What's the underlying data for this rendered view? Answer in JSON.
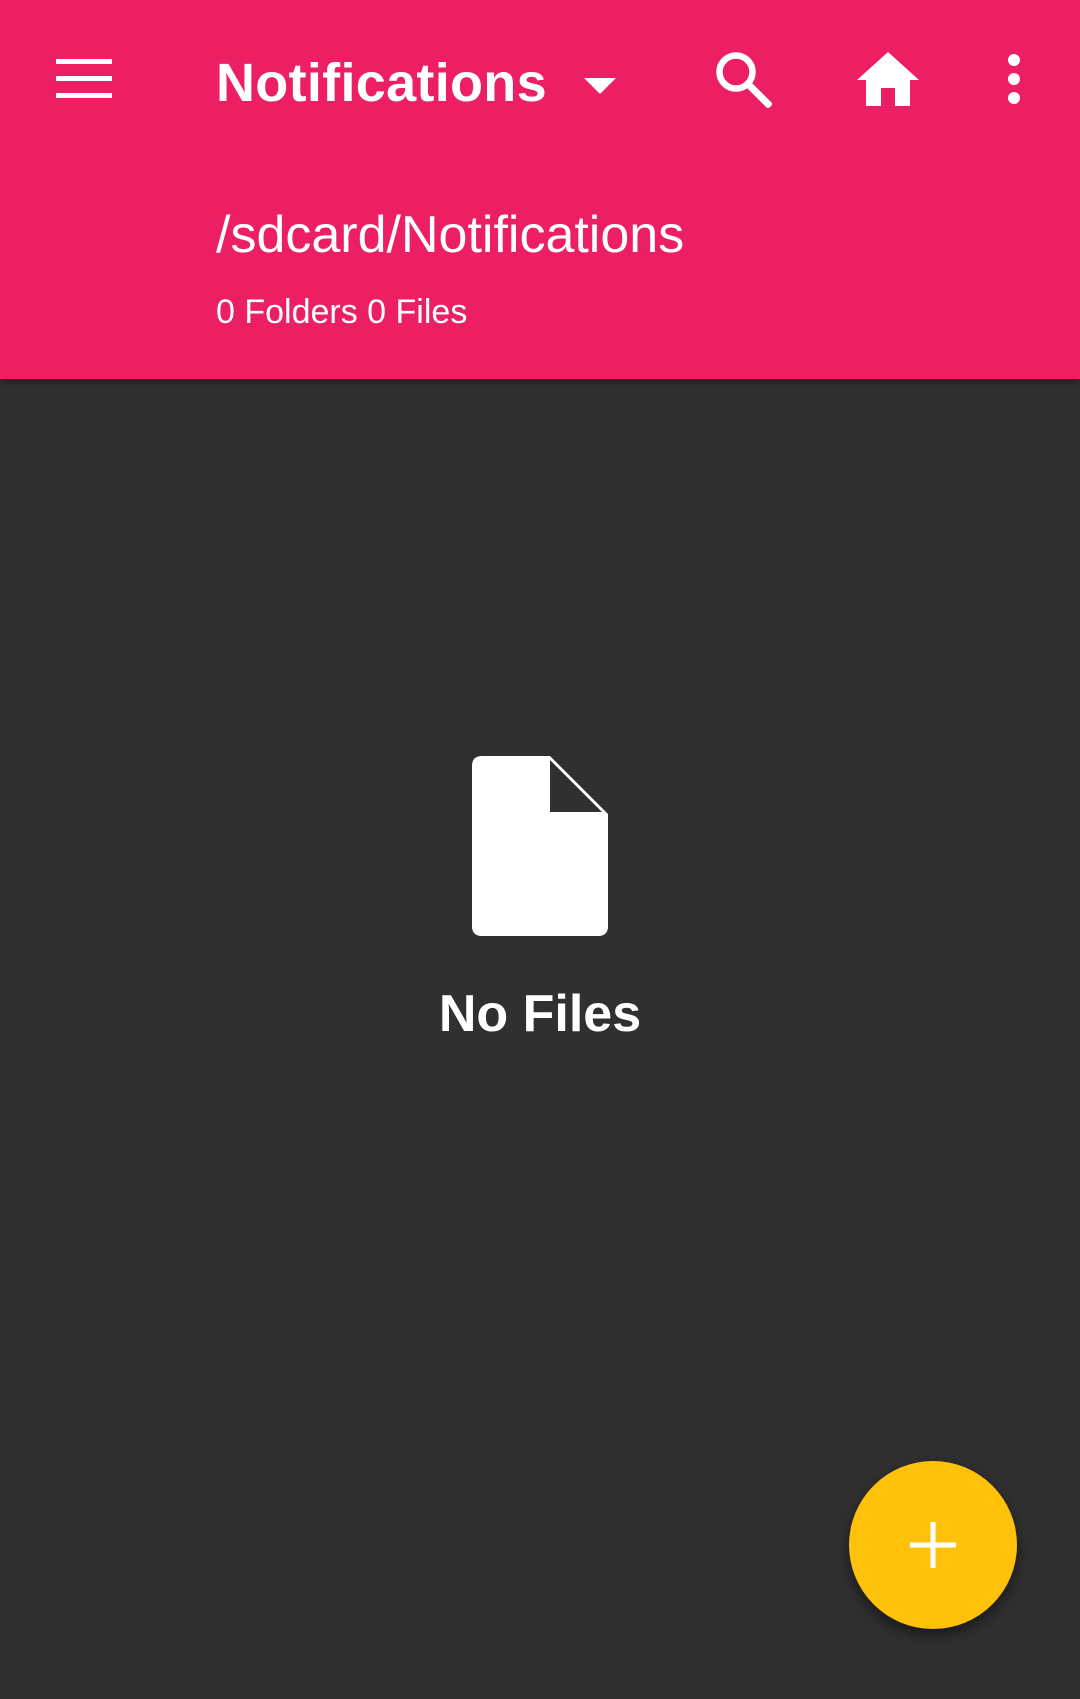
{
  "colors": {
    "appbar": "#EC1F63",
    "background": "#303030",
    "fab": "#FFC10A",
    "text": "#FFFFFF"
  },
  "toolbar": {
    "menu_icon": "hamburger-menu-icon",
    "title": "Notifications",
    "dropdown_icon": "caret-down-icon",
    "search_icon": "search-icon",
    "home_icon": "home-icon",
    "more_icon": "more-vert-icon"
  },
  "location": {
    "path": "/sdcard/Notifications",
    "summary": "0 Folders 0 Files"
  },
  "empty_state": {
    "icon": "file-icon",
    "label": "No Files"
  },
  "fab": {
    "icon": "plus-icon"
  }
}
